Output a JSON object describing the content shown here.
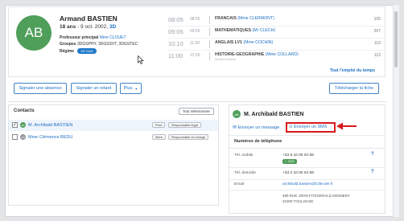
{
  "student": {
    "initials": "AB",
    "name": "Armand BASTIEN",
    "age": "18 ans",
    "birth": "- 9 oct. 2002,",
    "class": "3D",
    "prof_label": "Professeur principal",
    "prof_value": "Mme CLOUET",
    "groups_label": "Groupes",
    "groups_value": "3DGSPHY, 3DGSSVT, 3DGSTEC",
    "regime_label": "Régime",
    "regime_value": "DP DAN"
  },
  "schedule": [
    {
      "start": "08:05",
      "end": "08:55",
      "subject": "FRANCAIS",
      "teacher": "(Mme CLERMONT)",
      "room": "105",
      "note": ""
    },
    {
      "start": "09:05",
      "end": "09:55",
      "subject": "MATHEMATIQUES",
      "teacher": "(Mr CLECH)",
      "room": "207",
      "note": ""
    },
    {
      "start": "10:10",
      "end": "11:00",
      "subject": "ANGLAIS LV1",
      "teacher": "(Mme COCHIN)",
      "room": "110",
      "note": ""
    },
    {
      "start": "11:00",
      "end": "12:00",
      "subject": "HISTOIRE-GEOGRAPHIE",
      "teacher": "(Mme COLLARD)",
      "room": "112",
      "note": "Dernière séance"
    }
  ],
  "schedule_link": "Tout l'emploi du temps",
  "actions": {
    "absence": "Signaler une absence",
    "retard": "Signaler un retard",
    "plus": "Plus",
    "sheet": "Télécharger la fiche"
  },
  "contacts": {
    "title": "Contacts",
    "select_all": "Tout sélectionner",
    "rows": [
      {
        "initials": "AB",
        "name": "M. Archibald BASTIEN",
        "checked": "✓",
        "relation": "Père",
        "role": "Responsable légal"
      },
      {
        "initials": "CB",
        "name": "Mme Clémence BEDU",
        "checked": "",
        "relation": "Mère",
        "role": "Responsable en charge"
      }
    ]
  },
  "detail": {
    "initials": "AB",
    "name": "M. Archibald BASTIEN",
    "message": "Envoyer un message",
    "sms": "Envoyer un SMS",
    "phones_title": "Numéros de téléphone",
    "mobile_label": "Tél. mobile",
    "mobile_value": "+33 6 10 00 04 69",
    "sms_badge": "✓ SMS",
    "home_label": "Tél. domicile",
    "home_value": "+33 2 10 00 04 69",
    "email_label": "Email",
    "email_value": "archibald.bastien@icilecole.fr",
    "address_line1": "489 RUE JOHN FITZGERALD KENNEDY",
    "address_line2": "31000 TOULOUSE",
    "help_icon": "?"
  },
  "colors": {
    "accent": "#1e6fc4",
    "avatar": "#4f9e59",
    "highlight": "#d9191c"
  }
}
